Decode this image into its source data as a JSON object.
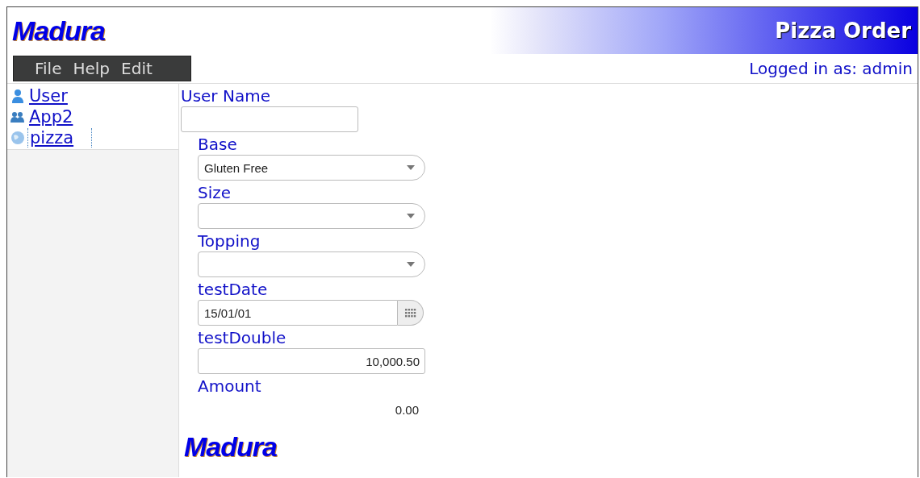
{
  "header": {
    "logo": "Madura",
    "title": "Pizza Order"
  },
  "menu": [
    "File",
    "Help",
    "Edit"
  ],
  "login": "Logged in as: admin",
  "sidebar": {
    "items": [
      {
        "label": "User",
        "kind": "person",
        "selected": false
      },
      {
        "label": "App2",
        "kind": "group",
        "selected": false
      },
      {
        "label": "pizza",
        "kind": "web",
        "selected": true
      }
    ]
  },
  "form": {
    "fields": [
      {
        "label": "User Name",
        "kind": "text"
      },
      {
        "label": "Base",
        "kind": "select",
        "value": "Gluten Free"
      },
      {
        "label": "Size",
        "kind": "select"
      },
      {
        "label": "Topping",
        "kind": "select"
      },
      {
        "label": "testDate",
        "kind": "date",
        "value": "15/01/01"
      },
      {
        "label": "testDouble",
        "kind": "number",
        "value": "10,000.50"
      },
      {
        "label": "Amount",
        "kind": "readonly",
        "value": "0.00"
      }
    ]
  },
  "footer": {
    "logo": "Madura"
  }
}
